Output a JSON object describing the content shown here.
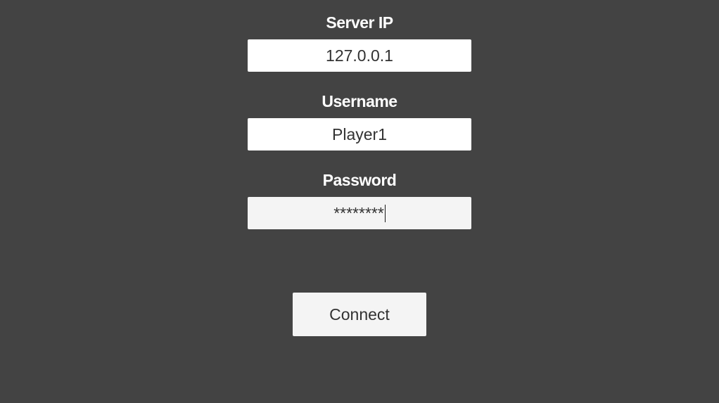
{
  "form": {
    "server_ip": {
      "label": "Server IP",
      "value": "127.0.0.1"
    },
    "username": {
      "label": "Username",
      "value": "Player1"
    },
    "password": {
      "label": "Password",
      "value": "********"
    },
    "connect_label": "Connect"
  },
  "colors": {
    "background": "#434343",
    "label_text": "#ffffff",
    "field_background": "#ffffff",
    "focused_field_background": "#f4f4f4",
    "field_text": "#323232"
  }
}
